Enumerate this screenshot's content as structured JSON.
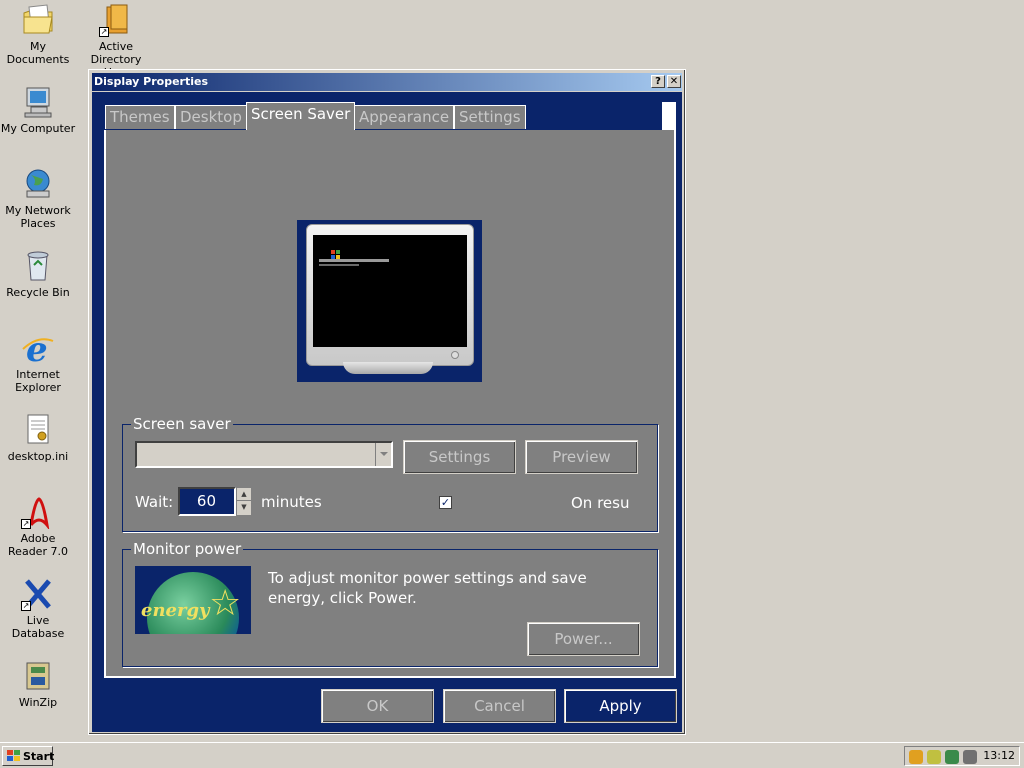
{
  "desktop": {
    "icons": [
      {
        "label": "My Documents"
      },
      {
        "label": "Active Directory Us..."
      },
      {
        "label": "My Computer"
      },
      {
        "label": "My Network Places"
      },
      {
        "label": "Recycle Bin"
      },
      {
        "label": "Internet Explorer"
      },
      {
        "label": "desktop.ini"
      },
      {
        "label": "Adobe Reader 7.0"
      },
      {
        "label": "Live Database"
      },
      {
        "label": "WinZip"
      }
    ]
  },
  "window": {
    "title": "Display Properties",
    "help_glyph": "?",
    "close_glyph": "✕",
    "tabs": [
      {
        "label": "Themes"
      },
      {
        "label": "Desktop"
      },
      {
        "label": "Screen Saver"
      },
      {
        "label": "Appearance"
      },
      {
        "label": "Settings"
      }
    ],
    "screen_saver": {
      "group_label": "Screen saver",
      "selected": "",
      "settings_label": "Settings",
      "preview_label": "Preview",
      "wait_label": "Wait:",
      "wait_value": "60",
      "minutes_label": "minutes",
      "on_resume_checked": true,
      "on_resume_label": "On resu"
    },
    "monitor_power": {
      "group_label": "Monitor power",
      "description": "To adjust monitor power settings and save energy, click Power.",
      "power_label": "Power...",
      "energy_logo_text": "energy"
    },
    "buttons": {
      "ok": "OK",
      "cancel": "Cancel",
      "apply": "Apply"
    }
  },
  "taskbar": {
    "start_label": "Start",
    "clock": "13:12"
  }
}
